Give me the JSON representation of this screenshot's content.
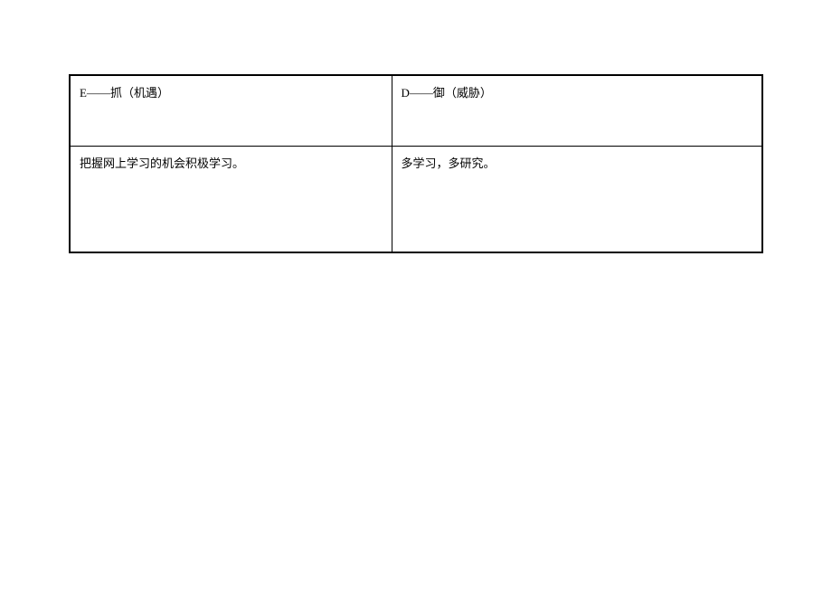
{
  "table": {
    "headers": {
      "col_e": "E——抓（机遇）",
      "col_d": "D——御（威胁）"
    },
    "content": {
      "col_e": "把握网上学习的机会积极学习。",
      "col_d": "多学习，多研究。"
    }
  }
}
